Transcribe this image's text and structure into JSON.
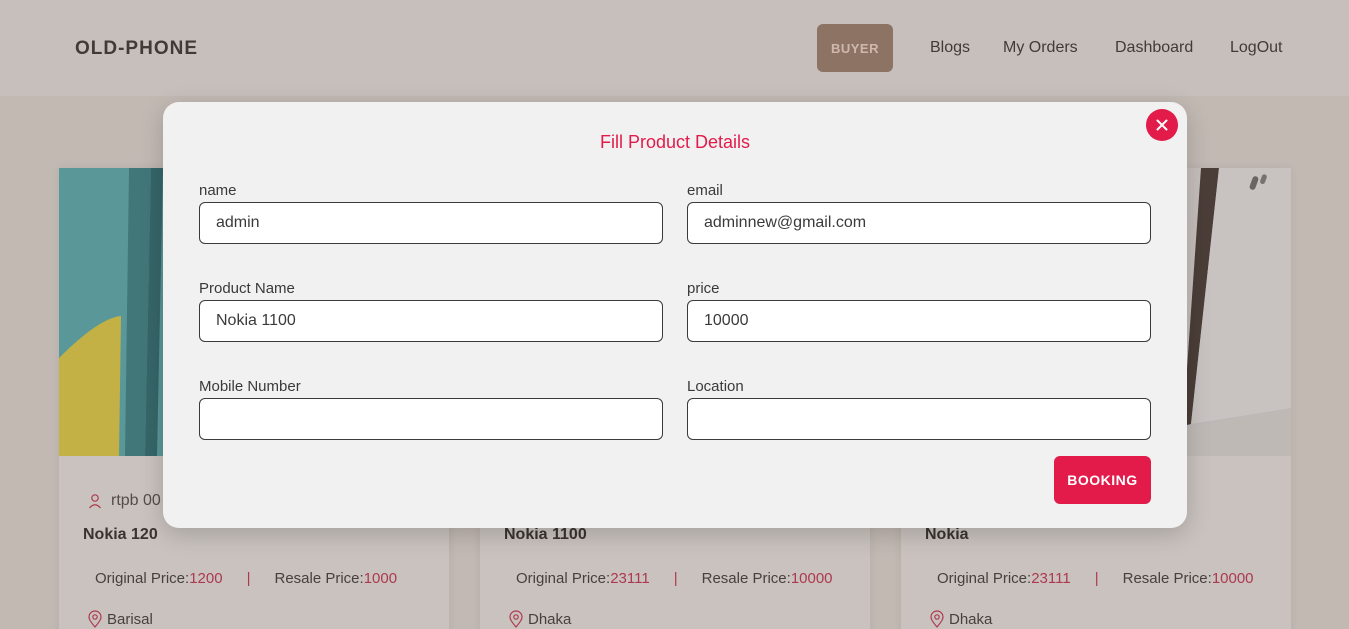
{
  "navbar": {
    "brand": "OLD-PHONE",
    "role_label": "BUYER",
    "links": [
      "Blogs",
      "My Orders",
      "Dashboard",
      "LogOut"
    ]
  },
  "cards": [
    {
      "seller": "rtpb 00",
      "title": "Nokia 120",
      "original_label": "Original Price: ",
      "original_price": "1200",
      "separator": "|",
      "resale_label": "Resale Price: ",
      "resale_price": "1000",
      "location": "Barisal"
    },
    {
      "seller": "",
      "title": "Nokia 1100",
      "original_label": "Original Price: ",
      "original_price": "23111",
      "separator": "|",
      "resale_label": "Resale Price: ",
      "resale_price": "10000",
      "location": "Dhaka"
    },
    {
      "seller": "",
      "title": "Nokia",
      "original_label": "Original Price: ",
      "original_price": "23111",
      "separator": "|",
      "resale_label": "Resale Price: ",
      "resale_price": "10000",
      "location": "Dhaka"
    }
  ],
  "modal": {
    "title": "Fill Product Details",
    "close_icon": "close-icon",
    "fields": {
      "name": {
        "label": "name",
        "value": "admin"
      },
      "email": {
        "label": "email",
        "value": "adminnew@gmail.com"
      },
      "product_name": {
        "label": "Product Name",
        "value": "Nokia 1100"
      },
      "price": {
        "label": "price",
        "value": "10000"
      },
      "mobile": {
        "label": "Mobile Number",
        "value": ""
      },
      "location": {
        "label": "Location",
        "value": ""
      }
    },
    "submit_label": "BOOKING"
  },
  "colors": {
    "accent": "#e31b4b",
    "role_button": "#a58a78",
    "price_text": "#d23a5a"
  }
}
